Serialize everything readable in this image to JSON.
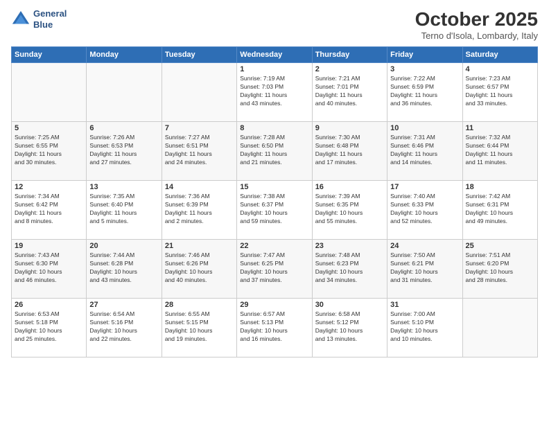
{
  "header": {
    "logo_line1": "General",
    "logo_line2": "Blue",
    "month": "October 2025",
    "location": "Terno d'Isola, Lombardy, Italy"
  },
  "weekdays": [
    "Sunday",
    "Monday",
    "Tuesday",
    "Wednesday",
    "Thursday",
    "Friday",
    "Saturday"
  ],
  "weeks": [
    [
      {
        "day": "",
        "info": ""
      },
      {
        "day": "",
        "info": ""
      },
      {
        "day": "",
        "info": ""
      },
      {
        "day": "1",
        "info": "Sunrise: 7:19 AM\nSunset: 7:03 PM\nDaylight: 11 hours\nand 43 minutes."
      },
      {
        "day": "2",
        "info": "Sunrise: 7:21 AM\nSunset: 7:01 PM\nDaylight: 11 hours\nand 40 minutes."
      },
      {
        "day": "3",
        "info": "Sunrise: 7:22 AM\nSunset: 6:59 PM\nDaylight: 11 hours\nand 36 minutes."
      },
      {
        "day": "4",
        "info": "Sunrise: 7:23 AM\nSunset: 6:57 PM\nDaylight: 11 hours\nand 33 minutes."
      }
    ],
    [
      {
        "day": "5",
        "info": "Sunrise: 7:25 AM\nSunset: 6:55 PM\nDaylight: 11 hours\nand 30 minutes."
      },
      {
        "day": "6",
        "info": "Sunrise: 7:26 AM\nSunset: 6:53 PM\nDaylight: 11 hours\nand 27 minutes."
      },
      {
        "day": "7",
        "info": "Sunrise: 7:27 AM\nSunset: 6:51 PM\nDaylight: 11 hours\nand 24 minutes."
      },
      {
        "day": "8",
        "info": "Sunrise: 7:28 AM\nSunset: 6:50 PM\nDaylight: 11 hours\nand 21 minutes."
      },
      {
        "day": "9",
        "info": "Sunrise: 7:30 AM\nSunset: 6:48 PM\nDaylight: 11 hours\nand 17 minutes."
      },
      {
        "day": "10",
        "info": "Sunrise: 7:31 AM\nSunset: 6:46 PM\nDaylight: 11 hours\nand 14 minutes."
      },
      {
        "day": "11",
        "info": "Sunrise: 7:32 AM\nSunset: 6:44 PM\nDaylight: 11 hours\nand 11 minutes."
      }
    ],
    [
      {
        "day": "12",
        "info": "Sunrise: 7:34 AM\nSunset: 6:42 PM\nDaylight: 11 hours\nand 8 minutes."
      },
      {
        "day": "13",
        "info": "Sunrise: 7:35 AM\nSunset: 6:40 PM\nDaylight: 11 hours\nand 5 minutes."
      },
      {
        "day": "14",
        "info": "Sunrise: 7:36 AM\nSunset: 6:39 PM\nDaylight: 11 hours\nand 2 minutes."
      },
      {
        "day": "15",
        "info": "Sunrise: 7:38 AM\nSunset: 6:37 PM\nDaylight: 10 hours\nand 59 minutes."
      },
      {
        "day": "16",
        "info": "Sunrise: 7:39 AM\nSunset: 6:35 PM\nDaylight: 10 hours\nand 55 minutes."
      },
      {
        "day": "17",
        "info": "Sunrise: 7:40 AM\nSunset: 6:33 PM\nDaylight: 10 hours\nand 52 minutes."
      },
      {
        "day": "18",
        "info": "Sunrise: 7:42 AM\nSunset: 6:31 PM\nDaylight: 10 hours\nand 49 minutes."
      }
    ],
    [
      {
        "day": "19",
        "info": "Sunrise: 7:43 AM\nSunset: 6:30 PM\nDaylight: 10 hours\nand 46 minutes."
      },
      {
        "day": "20",
        "info": "Sunrise: 7:44 AM\nSunset: 6:28 PM\nDaylight: 10 hours\nand 43 minutes."
      },
      {
        "day": "21",
        "info": "Sunrise: 7:46 AM\nSunset: 6:26 PM\nDaylight: 10 hours\nand 40 minutes."
      },
      {
        "day": "22",
        "info": "Sunrise: 7:47 AM\nSunset: 6:25 PM\nDaylight: 10 hours\nand 37 minutes."
      },
      {
        "day": "23",
        "info": "Sunrise: 7:48 AM\nSunset: 6:23 PM\nDaylight: 10 hours\nand 34 minutes."
      },
      {
        "day": "24",
        "info": "Sunrise: 7:50 AM\nSunset: 6:21 PM\nDaylight: 10 hours\nand 31 minutes."
      },
      {
        "day": "25",
        "info": "Sunrise: 7:51 AM\nSunset: 6:20 PM\nDaylight: 10 hours\nand 28 minutes."
      }
    ],
    [
      {
        "day": "26",
        "info": "Sunrise: 6:53 AM\nSunset: 5:18 PM\nDaylight: 10 hours\nand 25 minutes."
      },
      {
        "day": "27",
        "info": "Sunrise: 6:54 AM\nSunset: 5:16 PM\nDaylight: 10 hours\nand 22 minutes."
      },
      {
        "day": "28",
        "info": "Sunrise: 6:55 AM\nSunset: 5:15 PM\nDaylight: 10 hours\nand 19 minutes."
      },
      {
        "day": "29",
        "info": "Sunrise: 6:57 AM\nSunset: 5:13 PM\nDaylight: 10 hours\nand 16 minutes."
      },
      {
        "day": "30",
        "info": "Sunrise: 6:58 AM\nSunset: 5:12 PM\nDaylight: 10 hours\nand 13 minutes."
      },
      {
        "day": "31",
        "info": "Sunrise: 7:00 AM\nSunset: 5:10 PM\nDaylight: 10 hours\nand 10 minutes."
      },
      {
        "day": "",
        "info": ""
      }
    ]
  ]
}
